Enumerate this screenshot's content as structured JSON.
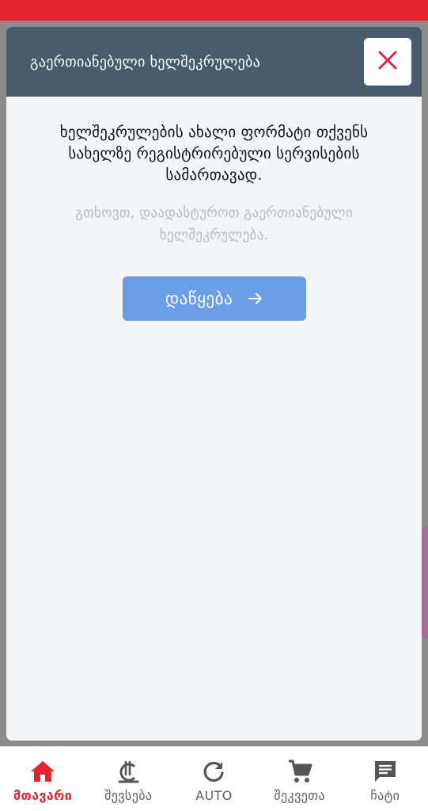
{
  "colors": {
    "brand_red": "#e3262d",
    "header_bg": "#485a6c",
    "button_blue": "#6b9ee6",
    "close_icon": "#d7263d",
    "nav_icon": "#555555"
  },
  "modal": {
    "title": "გაერთიანებული ხელშეკრულება",
    "close_icon": "close-icon",
    "lead_text": "ხელშეკრულების ახალი ფორმატი თქვენს სახელზე რეგისტრირებული სერვისების სამართავად.",
    "sub_text": "გთხოვთ, დაადასტუროთ გაერთიანებული ხელშეკრულება.",
    "start_button": "დაწყება",
    "start_icon": "arrow-right-icon"
  },
  "bottom_nav": {
    "items": [
      {
        "label": "მთავარი",
        "icon": "home-icon",
        "active": true
      },
      {
        "label": "შევსება",
        "icon": "lari-icon",
        "active": false
      },
      {
        "label": "AUTO",
        "icon": "refresh-icon",
        "active": false
      },
      {
        "label": "შეკვეთა",
        "icon": "cart-icon",
        "active": false
      },
      {
        "label": "ჩატი",
        "icon": "chat-icon",
        "active": false
      }
    ]
  }
}
